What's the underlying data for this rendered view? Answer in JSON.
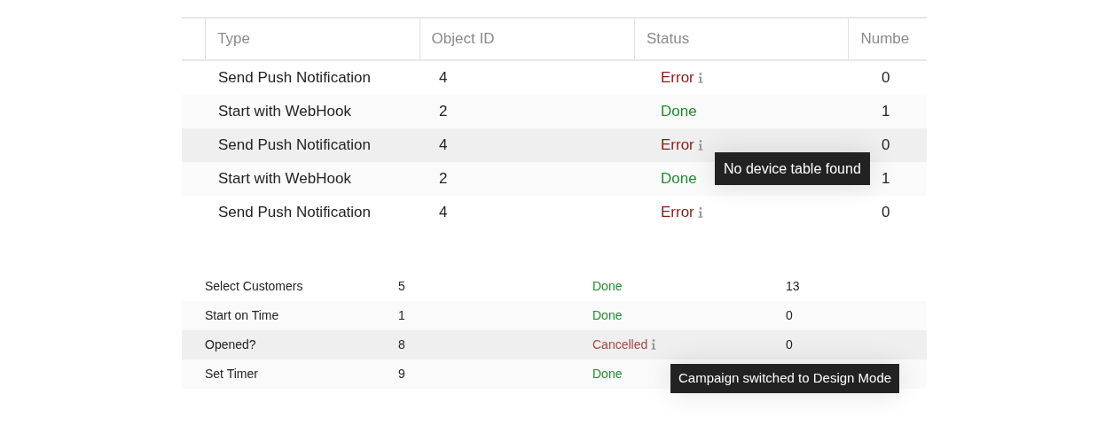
{
  "top_table": {
    "columns": [
      "Type",
      "Object ID",
      "Status",
      "Numbe"
    ],
    "rows": [
      {
        "type": "Send Push Notification",
        "object_id": "4",
        "status": {
          "text": "Error",
          "kind": "error",
          "info": true
        },
        "number": "0"
      },
      {
        "type": "Start with WebHook",
        "object_id": "2",
        "status": {
          "text": "Done",
          "kind": "done",
          "info": false
        },
        "number": "1"
      },
      {
        "type": "Send Push Notification",
        "object_id": "4",
        "status": {
          "text": "Error",
          "kind": "error",
          "info": true
        },
        "number": "0",
        "highlighted": true
      },
      {
        "type": "Start with WebHook",
        "object_id": "2",
        "status": {
          "text": "Done",
          "kind": "done",
          "info": false
        },
        "number": "1",
        "tooltip": "No device table found"
      },
      {
        "type": "Send Push Notification",
        "object_id": "4",
        "status": {
          "text": "Error",
          "kind": "error",
          "info": true
        },
        "number": "0"
      }
    ]
  },
  "bottom_table": {
    "rows": [
      {
        "type": "Select Customers",
        "object_id": "5",
        "status": {
          "text": "Done",
          "kind": "done",
          "info": false
        },
        "number": "13"
      },
      {
        "type": "Start on Time",
        "object_id": "1",
        "status": {
          "text": "Done",
          "kind": "done",
          "info": false
        },
        "number": "0"
      },
      {
        "type": "Opened?",
        "object_id": "8",
        "status": {
          "text": "Cancelled",
          "kind": "cancelled",
          "info": true
        },
        "number": "0",
        "highlighted": true
      },
      {
        "type": "Set Timer",
        "object_id": "9",
        "status": {
          "text": "Done",
          "kind": "done",
          "info": false
        },
        "tooltip": "Campaign switched to Design Mode"
      }
    ]
  }
}
